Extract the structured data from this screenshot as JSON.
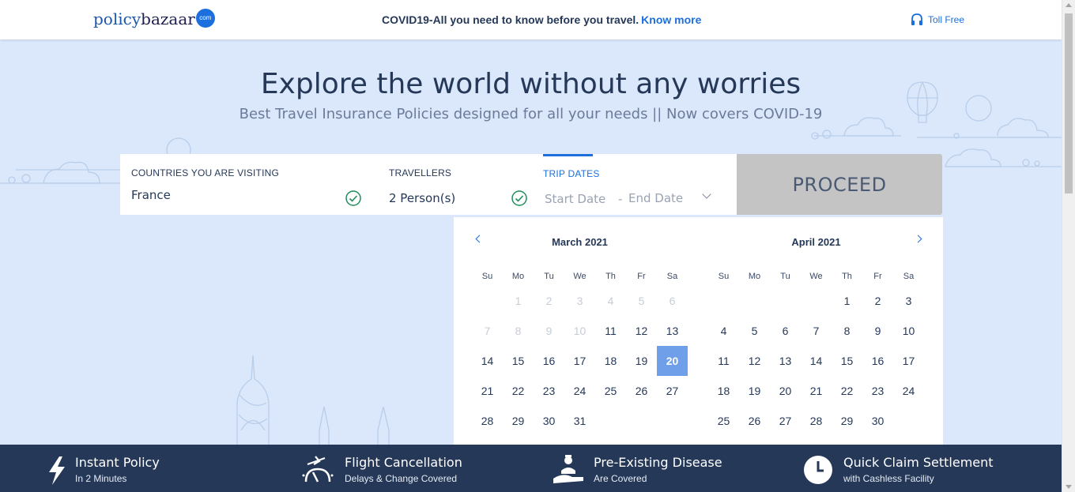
{
  "header": {
    "logo_text_a": "policy",
    "logo_text_b": "bazaar",
    "logo_badge": "com",
    "covid_text": "COVID19-All you need to know before you travel.",
    "covid_link": "Know more",
    "toll_free": "Toll Free"
  },
  "hero": {
    "title": "Explore the world without any worries",
    "subtitle": "Best Travel Insurance Policies designed for all your needs || Now covers COVID-19"
  },
  "search": {
    "countries_label": "COUNTRIES YOU ARE VISITING",
    "countries_value": "France",
    "travellers_label": "TRAVELLERS",
    "travellers_value": "2 Person(s)",
    "dates_label": "TRIP DATES",
    "start_placeholder": "Start Date",
    "separator": "-",
    "end_placeholder": "End Date",
    "proceed_label": "PROCEED"
  },
  "calendar": {
    "weekdays": [
      "Su",
      "Mo",
      "Tu",
      "We",
      "Th",
      "Fr",
      "Sa"
    ],
    "selected": "20",
    "months": [
      {
        "title": "March 2021",
        "first_weekday": 1,
        "days": 31,
        "disabled_until": 10
      },
      {
        "title": "April 2021",
        "first_weekday": 4,
        "days": 30,
        "disabled_until": 0
      }
    ]
  },
  "footer": {
    "features": [
      {
        "title": "Instant Policy",
        "subtitle": "In 2 Minutes"
      },
      {
        "title": "Flight Cancellation",
        "subtitle": "Delays & Change Covered"
      },
      {
        "title": "Pre-Existing Disease",
        "subtitle": "Are Covered"
      },
      {
        "title": "Quick Claim Settlement",
        "subtitle": "with Cashless Facility"
      }
    ]
  },
  "colors": {
    "brand_blue": "#1c6fdc",
    "navy": "#253858",
    "background": "#dbe8fb",
    "selected_day": "#6f9fe8",
    "check_green": "#1e8e5a"
  }
}
